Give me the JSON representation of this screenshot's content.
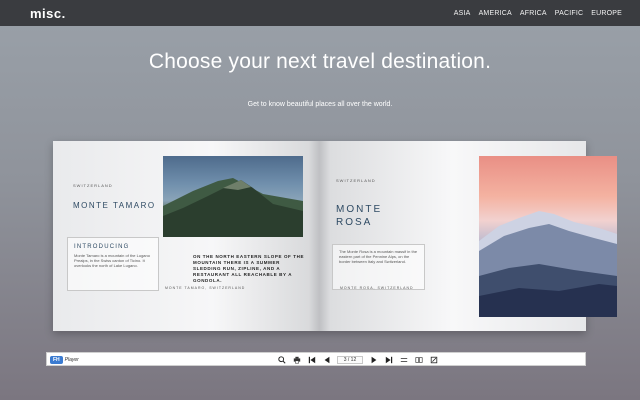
{
  "header": {
    "logo": "misc.",
    "nav": [
      "ASIA",
      "AMERICA",
      "AFRICA",
      "PACIFIC",
      "EUROPE"
    ]
  },
  "hero": {
    "title": "Choose your next travel destination.",
    "subtitle": "Get to know beautiful places all over the world."
  },
  "book": {
    "left": {
      "country": "SWITZERLAND",
      "title": "MONTE TAMARO",
      "intro_heading": "INTRODUCING",
      "intro_text": "Monte Tamaro is a mountain of the Lugano Prealps, in the Swiss canton of Ticino. It overlooks the north of Lake Lugano.",
      "north_text": "ON THE NORTH EASTERN SLOPE OF THE MOUNTAIN THERE IS A SUMMER SLEDDING RUN, ZIPLINE, AND A RESTAURANT ALL REACHABLE BY A GONDOLA.",
      "caption": "MONTE TAMARO, SWITZERLAND"
    },
    "right": {
      "country": "SWITZERLAND",
      "title_line1": "MONTE",
      "title_line2": "ROSA",
      "text": "The Monte Rosa is a mountain massif in the eastern part of the Pennine Alps, on the border between Italy and Switzerland.",
      "caption": "MONTE ROSA, SWITZERLAND"
    }
  },
  "viewer": {
    "brand_badge": "FH",
    "brand_text": "Player",
    "page_counter": "3 / 12",
    "icons": [
      "search-icon",
      "print-icon",
      "first-page-icon",
      "prev-page-icon",
      "next-page-icon",
      "last-page-icon",
      "fit-icon",
      "double-page-icon",
      "share-icon"
    ]
  }
}
